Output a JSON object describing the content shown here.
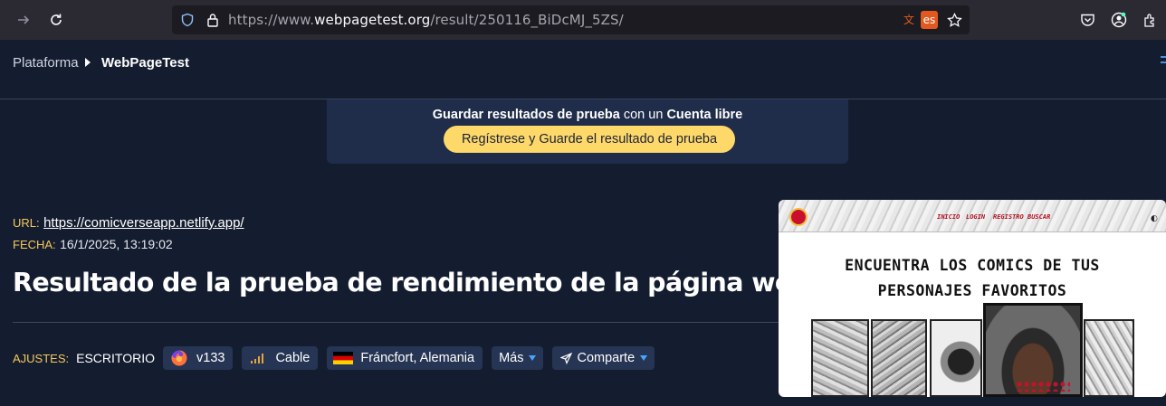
{
  "browser": {
    "url_prefix": "https://www.",
    "url_domain": "webpagetest.org",
    "url_path": "/result/250116_BiDcMJ_5ZS/",
    "translate_lang": "es",
    "icons": [
      "back-arrow-icon",
      "reload-icon",
      "shield-icon",
      "lock-icon",
      "translate-icon",
      "star-icon",
      "pocket-icon",
      "account-icon",
      "extensions-icon"
    ]
  },
  "header": {
    "breadcrumb_root": "Plataforma",
    "breadcrumb_current": "WebPageTest"
  },
  "promo": {
    "bold_1": "Guardar resultados de prueba",
    "connector": " con un ",
    "bold_2": "Cuenta libre",
    "button": "Regístrese y Guarde el resultado de prueba"
  },
  "meta": {
    "url_label": "URL:",
    "url_value": "https://comicverseapp.netlify.app/",
    "date_label": "FECHA:",
    "date_value": "16/1/2025, 13:19:02"
  },
  "title": "Resultado de la prueba de rendimiento de la página web",
  "settings": {
    "label": "AJUSTES:",
    "device": "ESCRITORIO",
    "browser_version": "v133",
    "connection": "Cable",
    "location": "Fráncfort, Alemania",
    "more": "Más",
    "share": "Comparte"
  },
  "thumbnail": {
    "nav_links": [
      "INICIO",
      "LOGIN",
      "REGISTRO",
      "BUSCAR"
    ],
    "headline_1": "ENCUENTRA LOS COMICS DE TUS",
    "headline_2": "PERSONAJES FAVORITOS"
  },
  "colors": {
    "page_bg": "#141d30",
    "accent_yellow": "#fed969",
    "label_yellow": "#f5c85a",
    "pill_bg": "#263554"
  }
}
